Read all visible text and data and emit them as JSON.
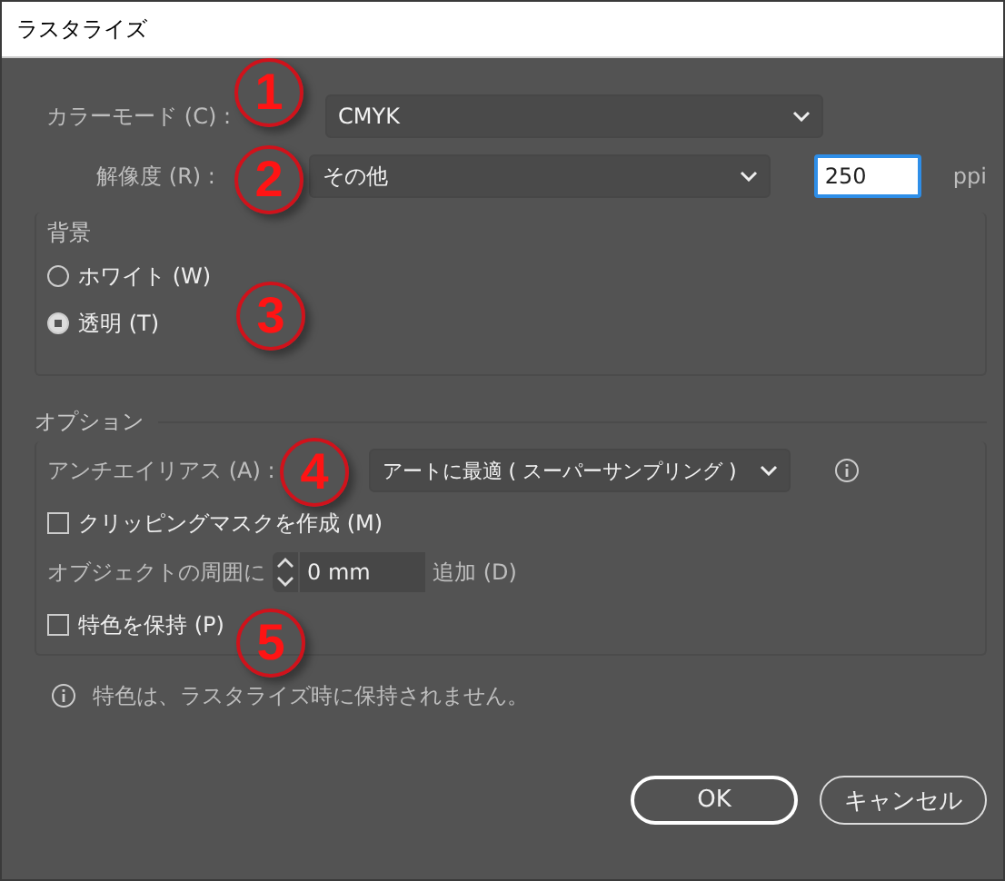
{
  "window": {
    "title": "ラスタライズ"
  },
  "color_mode": {
    "label": "カラーモード (C) :",
    "value": "CMYK"
  },
  "resolution": {
    "label": "解像度 (R) :",
    "value": "その他",
    "ppi_value": "250",
    "unit": "ppi"
  },
  "background": {
    "title": "背景",
    "options": [
      {
        "label": "ホワイト (W)",
        "selected": false
      },
      {
        "label": "透明 (T)",
        "selected": true
      }
    ]
  },
  "options": {
    "title": "オプション",
    "antialias": {
      "label": "アンチエイリアス (A) :",
      "value": "アートに最適 ( スーパーサンプリング )"
    },
    "clipping_mask": {
      "label": "クリッピングマスクを作成 (M)",
      "checked": false
    },
    "padding": {
      "label": "オブジェクトの周囲に",
      "value": "0 mm",
      "suffix": "追加 (D)"
    },
    "preserve_spot": {
      "label": "特色を保持 (P)",
      "checked": false
    }
  },
  "info": "特色は、ラスタライズ時に保持されません。",
  "buttons": [
    {
      "label": "OK",
      "default": true
    },
    {
      "label": "キャンセル",
      "default": false
    }
  ],
  "annotations": [
    {
      "number": "1"
    },
    {
      "number": "2"
    },
    {
      "number": "3"
    },
    {
      "number": "4"
    },
    {
      "number": "5"
    }
  ]
}
